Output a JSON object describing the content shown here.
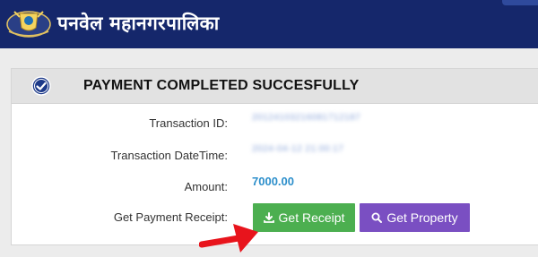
{
  "header": {
    "title": "पनवेल महानगरपालिका",
    "background_color": "#15276b",
    "logo_icon": "municipal-emblem"
  },
  "card": {
    "status_icon": "check-circle-icon",
    "title": "PAYMENT COMPLETED SUCCESFULLY",
    "rows": {
      "transaction_id": {
        "label": "Transaction ID:",
        "value": "20124103216081712187"
      },
      "transaction_datetime": {
        "label": "Transaction DateTime:",
        "value": "2024-04-12 21:00:17"
      },
      "amount": {
        "label": "Amount:",
        "value": "7000.00"
      },
      "receipt": {
        "label": "Get Payment Receipt:"
      }
    },
    "buttons": {
      "receipt_label": "Get Receipt",
      "receipt_icon": "download-icon",
      "receipt_color": "#4caf50",
      "property_label": "Get Property",
      "property_icon": "search-icon",
      "property_color": "#7a4fc2"
    }
  },
  "annotation": {
    "arrow_color": "#e8141c"
  }
}
